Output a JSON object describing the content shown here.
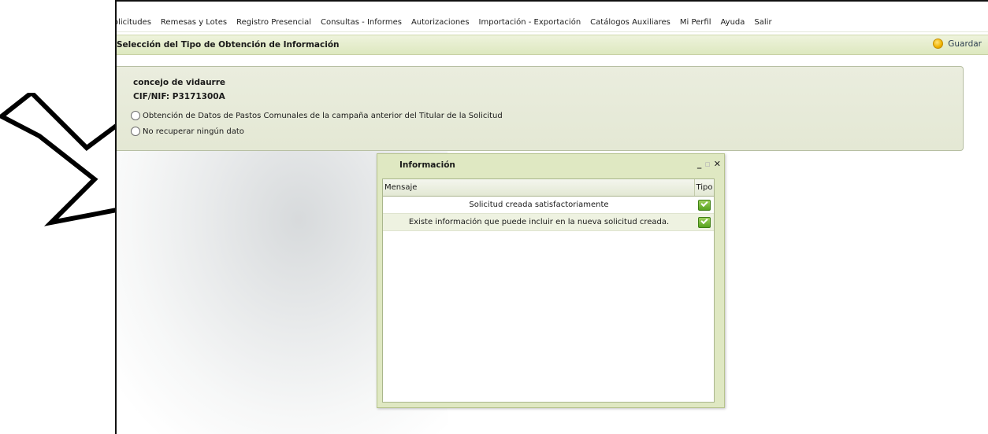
{
  "menu": [
    "olicitudes",
    "Remesas y Lotes",
    "Registro Presencial",
    "Consultas - Informes",
    "Autorizaciones",
    "Importación - Exportación",
    "Catálogos Auxiliares",
    "Mi Perfil",
    "Ayuda",
    "Salir"
  ],
  "page": {
    "title": "Selección del Tipo de Obtención de Información",
    "save_label": "Guardar"
  },
  "panel": {
    "name": "concejo de vidaurre",
    "cif": "CIF/NIF: P3171300A",
    "option1": "Obtención de Datos de Pastos Comunales de la campaña anterior del Titular de la Solicitud",
    "option2": "No recuperar ningún dato"
  },
  "dialog": {
    "title": "Información",
    "col_message": "Mensaje",
    "col_type": "Tipo",
    "rows": [
      {
        "message": "Solicitud creada satisfactoriamente",
        "type_icon": "check-icon"
      },
      {
        "message": "Existe información que puede incluir en la nueva solicitud creada.",
        "type_icon": "check-icon"
      }
    ]
  },
  "colors": {
    "title_bar": "#dde8bf",
    "panel": "#e7ebd8",
    "dialog": "#dfe8c2"
  }
}
